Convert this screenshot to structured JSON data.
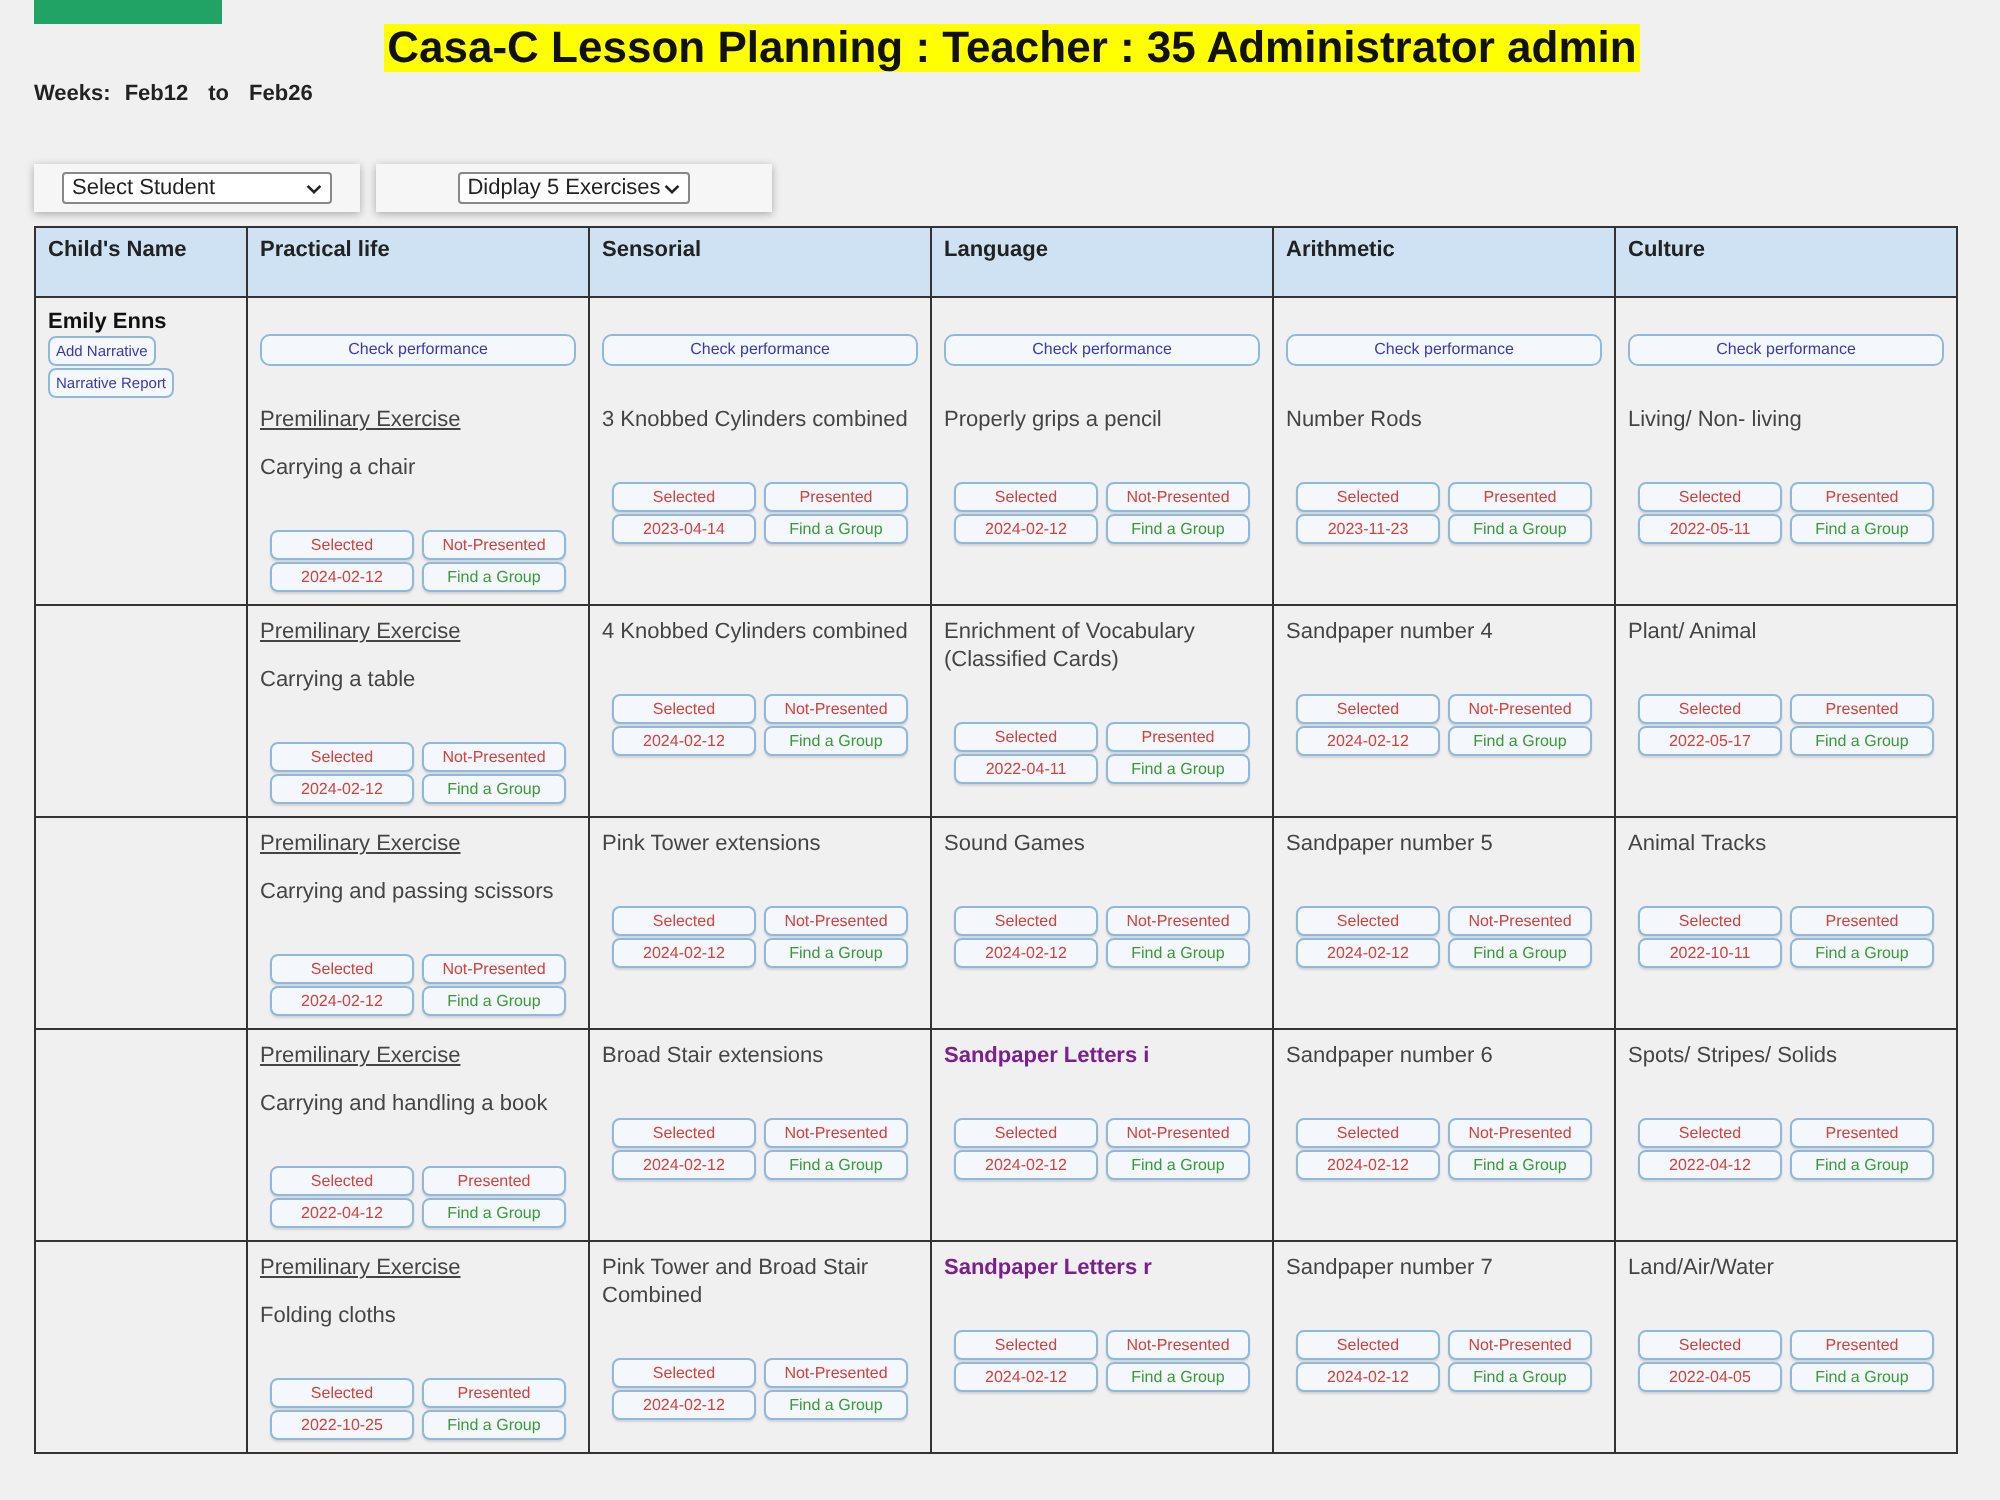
{
  "page": {
    "title": "Casa-C Lesson Planning : Teacher : 35 Administrator admin",
    "weeks": {
      "label": "Weeks:",
      "from": "Feb12",
      "separator": "to",
      "to": "Feb26"
    }
  },
  "filters": [
    {
      "value": "Select Student"
    },
    {
      "value": "Didplay 5 Exercises"
    }
  ],
  "table": {
    "columns": [
      "Child's Name",
      "Practical life",
      "Sensorial",
      "Language",
      "Arithmetic",
      "Culture"
    ],
    "rows": [
      {
        "cells": [
          {
            "name": "Emily Enns",
            "buttons": [
              "Add Narrative",
              "Narrative Report"
            ]
          },
          {
            "check_button": "Check performance",
            "heading": "Premilinary Exercise",
            "title": "Carrying a chair",
            "highlighted": false,
            "status": "Selected",
            "presentation": "Not-Presented",
            "date": "2024-02-12",
            "group_button": "Find a Group"
          },
          {
            "check_button": "Check performance",
            "title": "3 Knobbed Cylinders combined",
            "highlighted": false,
            "status": "Selected",
            "presentation": "Presented",
            "date": "2023-04-14",
            "group_button": "Find a Group"
          },
          {
            "check_button": "Check performance",
            "title": "Properly grips a pencil",
            "highlighted": false,
            "status": "Selected",
            "presentation": "Not-Presented",
            "date": "2024-02-12",
            "group_button": "Find a Group"
          },
          {
            "check_button": "Check performance",
            "title": "Number Rods",
            "highlighted": false,
            "status": "Selected",
            "presentation": "Presented",
            "date": "2023-11-23",
            "group_button": "Find a Group"
          },
          {
            "check_button": "Check performance",
            "title": "Living/ Non- living",
            "highlighted": false,
            "status": "Selected",
            "presentation": "Presented",
            "date": "2022-05-11",
            "group_button": "Find a Group"
          }
        ]
      },
      {
        "cells": [
          "",
          {
            "heading": "Premilinary Exercise",
            "title": "Carrying a table",
            "highlighted": false,
            "status": "Selected",
            "presentation": "Not-Presented",
            "date": "2024-02-12",
            "group_button": "Find a Group"
          },
          {
            "title": "4 Knobbed Cylinders combined",
            "highlighted": false,
            "status": "Selected",
            "presentation": "Not-Presented",
            "date": "2024-02-12",
            "group_button": "Find a Group"
          },
          {
            "title": "Enrichment of Vocabulary (Classified Cards)",
            "highlighted": false,
            "status": "Selected",
            "presentation": "Presented",
            "date": "2022-04-11",
            "group_button": "Find a Group"
          },
          {
            "title": "Sandpaper number 4",
            "highlighted": false,
            "status": "Selected",
            "presentation": "Not-Presented",
            "date": "2024-02-12",
            "group_button": "Find a Group"
          },
          {
            "title": "Plant/ Animal",
            "highlighted": false,
            "status": "Selected",
            "presentation": "Presented",
            "date": "2022-05-17",
            "group_button": "Find a Group"
          }
        ]
      },
      {
        "cells": [
          "",
          {
            "heading": "Premilinary Exercise",
            "title": "Carrying and passing scissors",
            "highlighted": false,
            "status": "Selected",
            "presentation": "Not-Presented",
            "date": "2024-02-12",
            "group_button": "Find a Group"
          },
          {
            "title": "Pink Tower extensions",
            "highlighted": false,
            "status": "Selected",
            "presentation": "Not-Presented",
            "date": "2024-02-12",
            "group_button": "Find a Group"
          },
          {
            "title": "Sound Games",
            "highlighted": false,
            "status": "Selected",
            "presentation": "Not-Presented",
            "date": "2024-02-12",
            "group_button": "Find a Group"
          },
          {
            "title": "Sandpaper number 5",
            "highlighted": false,
            "status": "Selected",
            "presentation": "Not-Presented",
            "date": "2024-02-12",
            "group_button": "Find a Group"
          },
          {
            "title": "Animal Tracks",
            "highlighted": false,
            "status": "Selected",
            "presentation": "Presented",
            "date": "2022-10-11",
            "group_button": "Find a Group"
          }
        ]
      },
      {
        "cells": [
          "",
          {
            "heading": "Premilinary Exercise",
            "title": "Carrying and handling a book",
            "highlighted": false,
            "status": "Selected",
            "presentation": "Presented",
            "date": "2022-04-12",
            "group_button": "Find a Group"
          },
          {
            "title": "Broad Stair extensions",
            "highlighted": false,
            "status": "Selected",
            "presentation": "Not-Presented",
            "date": "2024-02-12",
            "group_button": "Find a Group"
          },
          {
            "title": "Sandpaper Letters i",
            "highlighted": true,
            "status": "Selected",
            "presentation": "Not-Presented",
            "date": "2024-02-12",
            "group_button": "Find a Group"
          },
          {
            "title": "Sandpaper number 6",
            "highlighted": false,
            "status": "Selected",
            "presentation": "Not-Presented",
            "date": "2024-02-12",
            "group_button": "Find a Group"
          },
          {
            "title": "Spots/ Stripes/ Solids",
            "highlighted": false,
            "status": "Selected",
            "presentation": "Presented",
            "date": "2022-04-12",
            "group_button": "Find a Group"
          }
        ]
      },
      {
        "cells": [
          "",
          {
            "heading": "Premilinary Exercise",
            "title": "Folding cloths",
            "highlighted": false,
            "status": "Selected",
            "presentation": "Presented",
            "date": "2022-10-25",
            "group_button": "Find a Group"
          },
          {
            "title": "Pink Tower and Broad Stair Combined",
            "highlighted": false,
            "status": "Selected",
            "presentation": "Not-Presented",
            "date": "2024-02-12",
            "group_button": "Find a Group"
          },
          {
            "title": "Sandpaper Letters r",
            "highlighted": true,
            "status": "Selected",
            "presentation": "Not-Presented",
            "date": "2024-02-12",
            "group_button": "Find a Group"
          },
          {
            "title": "Sandpaper number 7",
            "highlighted": false,
            "status": "Selected",
            "presentation": "Not-Presented",
            "date": "2024-02-12",
            "group_button": "Find a Group"
          },
          {
            "title": "Land/Air/Water",
            "highlighted": false,
            "status": "Selected",
            "presentation": "Presented",
            "date": "2022-04-05",
            "group_button": "Find a Group"
          }
        ]
      }
    ]
  }
}
